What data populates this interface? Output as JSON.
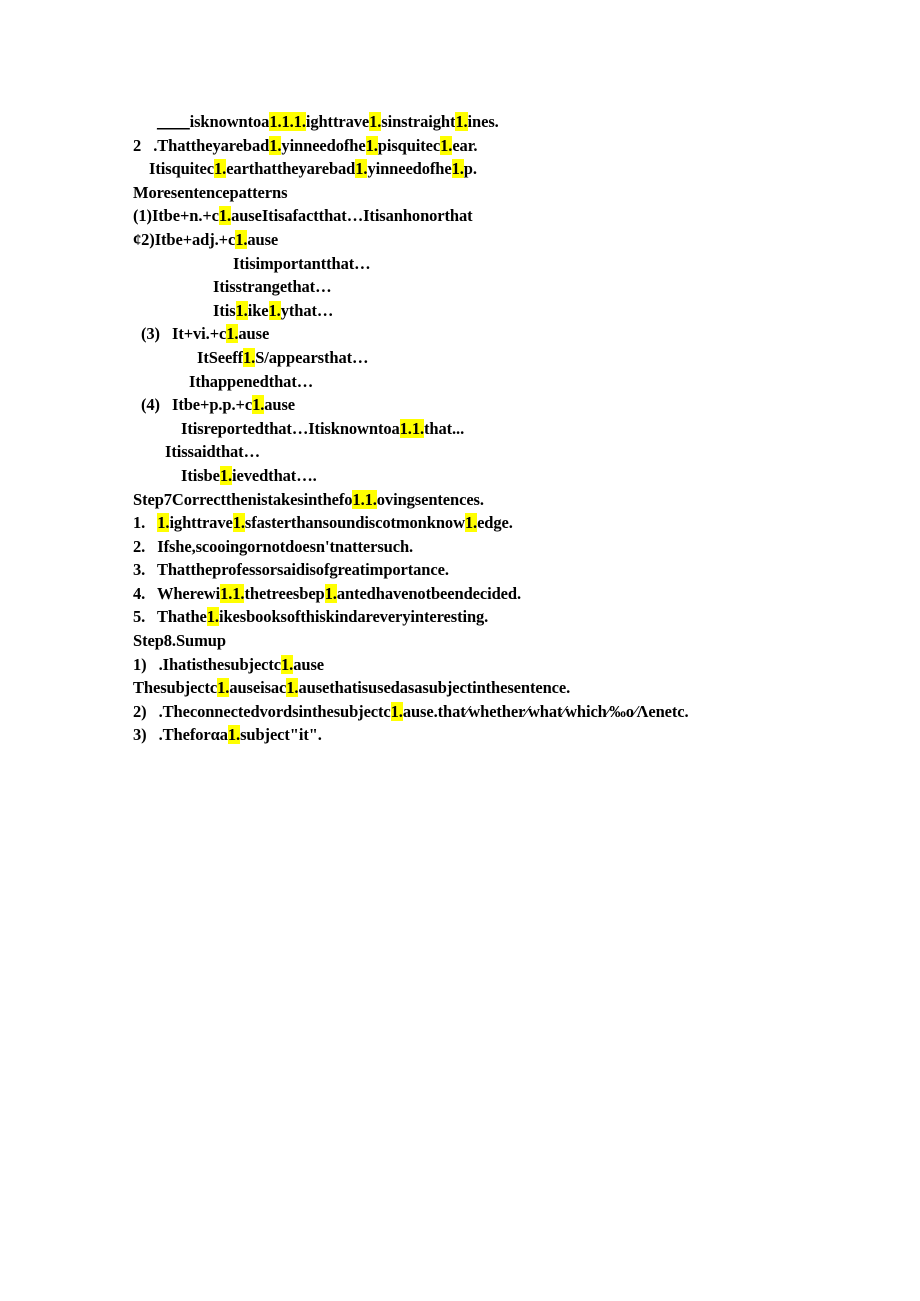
{
  "document": {
    "page_background": "#ffffff",
    "text_color": "#000000",
    "highlight_color": "#ffff00",
    "lines": [
      {
        "id": "line-1",
        "indent": "i-3",
        "segments": [
          {
            "text": "____",
            "style": "underline"
          },
          {
            "text": "isknowntoa",
            "style": "plain"
          },
          {
            "text": "1.1.1.",
            "style": "highlight"
          },
          {
            "text": "ighttrave",
            "style": "plain"
          },
          {
            "text": "1.",
            "style": "highlight"
          },
          {
            "text": "sinstraight",
            "style": "plain"
          },
          {
            "text": "1.",
            "style": "highlight"
          },
          {
            "text": "ines.",
            "style": "plain"
          }
        ]
      },
      {
        "id": "line-2",
        "indent": "i-0",
        "segments": [
          {
            "text": "2   .Thattheyarebad",
            "style": "plain"
          },
          {
            "text": "1.",
            "style": "highlight"
          },
          {
            "text": "yinneedofhe",
            "style": "plain"
          },
          {
            "text": "1.",
            "style": "highlight"
          },
          {
            "text": "pisquitec",
            "style": "plain"
          },
          {
            "text": "1.",
            "style": "highlight"
          },
          {
            "text": "ear.",
            "style": "plain"
          }
        ]
      },
      {
        "id": "line-3",
        "indent": "i-2",
        "segments": [
          {
            "text": "Itisquitec",
            "style": "plain"
          },
          {
            "text": "1.",
            "style": "highlight"
          },
          {
            "text": "earthattheyarebad",
            "style": "plain"
          },
          {
            "text": "1.",
            "style": "highlight"
          },
          {
            "text": "yinneedofhe",
            "style": "plain"
          },
          {
            "text": "1.",
            "style": "highlight"
          },
          {
            "text": "p.",
            "style": "plain"
          }
        ]
      },
      {
        "id": "line-4",
        "indent": "i-0",
        "segments": [
          {
            "text": "Moresentencepatterns",
            "style": "plain"
          }
        ]
      },
      {
        "id": "line-5",
        "indent": "i-0",
        "segments": [
          {
            "text": "(1)Itbe+n.+c",
            "style": "plain"
          },
          {
            "text": "1.",
            "style": "highlight"
          },
          {
            "text": "auseItisafactthat…Itisanhonorthat",
            "style": "plain"
          }
        ]
      },
      {
        "id": "line-6",
        "indent": "i-0",
        "segments": [
          {
            "text": "¢2)Itbe+adj.+c",
            "style": "plain"
          },
          {
            "text": "1.",
            "style": "highlight"
          },
          {
            "text": "ause",
            "style": "plain"
          }
        ]
      },
      {
        "id": "line-7",
        "indent": "i-9",
        "segments": [
          {
            "text": "Itisimportantthat…",
            "style": "plain"
          }
        ]
      },
      {
        "id": "line-8",
        "indent": "i-8",
        "segments": [
          {
            "text": "Itisstrangethat…",
            "style": "plain"
          }
        ]
      },
      {
        "id": "line-9",
        "indent": "i-8",
        "segments": [
          {
            "text": "Itis",
            "style": "plain"
          },
          {
            "text": "1.",
            "style": "highlight"
          },
          {
            "text": "ike",
            "style": "plain"
          },
          {
            "text": "1.",
            "style": "highlight"
          },
          {
            "text": "ythat…",
            "style": "plain"
          }
        ]
      },
      {
        "id": "line-10",
        "indent": "i-1",
        "segments": [
          {
            "text": "(3)   It+vi.+c",
            "style": "plain"
          },
          {
            "text": "1.",
            "style": "highlight"
          },
          {
            "text": "ause",
            "style": "plain"
          }
        ]
      },
      {
        "id": "line-11",
        "indent": "i-7",
        "segments": [
          {
            "text": "ItSeeff",
            "style": "plain"
          },
          {
            "text": "1.",
            "style": "highlight"
          },
          {
            "text": "S/appearsthat…",
            "style": "plain"
          }
        ]
      },
      {
        "id": "line-12",
        "indent": "i-6",
        "segments": [
          {
            "text": "Ithappenedthat…",
            "style": "plain"
          }
        ]
      },
      {
        "id": "line-13",
        "indent": "i-1",
        "segments": [
          {
            "text": "(4)   Itbe+p.p.+c",
            "style": "plain"
          },
          {
            "text": "1.",
            "style": "highlight"
          },
          {
            "text": "ause",
            "style": "plain"
          }
        ]
      },
      {
        "id": "line-14",
        "indent": "i-5",
        "segments": [
          {
            "text": "Itisreportedthat…Itisknowntoa",
            "style": "plain"
          },
          {
            "text": "1.1.",
            "style": "highlight"
          },
          {
            "text": "that...",
            "style": "plain"
          }
        ]
      },
      {
        "id": "line-15",
        "indent": "i-4",
        "segments": [
          {
            "text": "Itissaidthat…",
            "style": "plain"
          }
        ]
      },
      {
        "id": "line-16",
        "indent": "i-5",
        "segments": [
          {
            "text": "Itisbe",
            "style": "plain"
          },
          {
            "text": "1.",
            "style": "highlight"
          },
          {
            "text": "ievedthat….",
            "style": "plain"
          }
        ]
      },
      {
        "id": "line-17",
        "indent": "i-0",
        "segments": [
          {
            "text": "Step7Correctthenistakesinthefo",
            "style": "plain"
          },
          {
            "text": "1.1.",
            "style": "highlight"
          },
          {
            "text": "ovingsentences.",
            "style": "plain"
          }
        ]
      },
      {
        "id": "line-18",
        "indent": "i-0",
        "segments": [
          {
            "text": "1.   ",
            "style": "plain"
          },
          {
            "text": "1.",
            "style": "highlight"
          },
          {
            "text": "ighttrave",
            "style": "plain"
          },
          {
            "text": "1.",
            "style": "highlight"
          },
          {
            "text": "sfasterthansoundiscotmonknow",
            "style": "plain"
          },
          {
            "text": "1.",
            "style": "highlight"
          },
          {
            "text": "edge.",
            "style": "plain"
          }
        ]
      },
      {
        "id": "line-19",
        "indent": "i-0",
        "segments": [
          {
            "text": "2.   Ifshe,scooingornotdoesn'tnattersuch.",
            "style": "plain"
          }
        ]
      },
      {
        "id": "line-20",
        "indent": "i-0",
        "segments": [
          {
            "text": "3.   Thattheprofessorsaidisofgreatimportance.",
            "style": "plain"
          }
        ]
      },
      {
        "id": "line-21",
        "indent": "i-0",
        "segments": [
          {
            "text": "4.   Wherewi",
            "style": "plain"
          },
          {
            "text": "1.1.",
            "style": "highlight"
          },
          {
            "text": "thetreesbep",
            "style": "plain"
          },
          {
            "text": "1.",
            "style": "highlight"
          },
          {
            "text": "antedhavenotbeendecided.",
            "style": "plain"
          }
        ]
      },
      {
        "id": "line-22",
        "indent": "i-0",
        "segments": [
          {
            "text": "5.   Thathe",
            "style": "plain"
          },
          {
            "text": "1.",
            "style": "highlight"
          },
          {
            "text": "ikesbooksofthiskindareveryinteresting.",
            "style": "plain"
          }
        ]
      },
      {
        "id": "line-23",
        "indent": "i-0",
        "segments": [
          {
            "text": "Step8.Sumup",
            "style": "plain"
          }
        ]
      },
      {
        "id": "line-24",
        "indent": "i-0",
        "segments": [
          {
            "text": "1)   .Ihatisthesubjectc",
            "style": "plain"
          },
          {
            "text": "1.",
            "style": "highlight"
          },
          {
            "text": "ause",
            "style": "plain"
          }
        ]
      },
      {
        "id": "line-25",
        "indent": "i-0",
        "segments": [
          {
            "text": "Thesubjectc",
            "style": "plain"
          },
          {
            "text": "1.",
            "style": "highlight"
          },
          {
            "text": "auseisac",
            "style": "plain"
          },
          {
            "text": "1.",
            "style": "highlight"
          },
          {
            "text": "ausethatisusedasasubjectinthesentence.",
            "style": "plain"
          }
        ]
      },
      {
        "id": "line-26",
        "indent": "i-0",
        "segments": [
          {
            "text": "2)   .Theconnectedvordsinthesubjectc",
            "style": "plain"
          },
          {
            "text": "1.",
            "style": "highlight"
          },
          {
            "text": "ause.that⁄whether⁄what⁄which⁄‰o⁄Λenetc.",
            "style": "plain"
          }
        ]
      },
      {
        "id": "line-27",
        "indent": "i-0",
        "segments": [
          {
            "text": "3)   .Theforαa",
            "style": "plain"
          },
          {
            "text": "1.",
            "style": "highlight"
          },
          {
            "text": "subject\"it\".",
            "style": "plain"
          }
        ]
      }
    ]
  }
}
